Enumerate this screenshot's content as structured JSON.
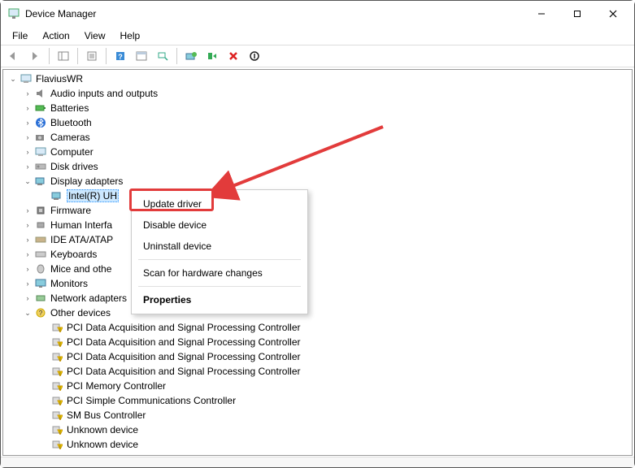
{
  "window": {
    "title": "Device Manager"
  },
  "menu": {
    "file": "File",
    "action": "Action",
    "view": "View",
    "help": "Help"
  },
  "root": {
    "name": "FlaviusWR"
  },
  "categories": {
    "audio": "Audio inputs and outputs",
    "batteries": "Batteries",
    "bluetooth": "Bluetooth",
    "cameras": "Cameras",
    "computer": "Computer",
    "disk": "Disk drives",
    "display": "Display adapters",
    "firmware": "Firmware",
    "hid": "Human Interfa",
    "ide": "IDE ATA/ATAP",
    "keyboards": "Keyboards",
    "mice": "Mice and othe",
    "monitors": "Monitors",
    "network": "Network adapters",
    "other": "Other devices"
  },
  "display_child": "Intel(R) UH",
  "other_devices": {
    "d0": "PCI Data Acquisition and Signal Processing Controller",
    "d1": "PCI Data Acquisition and Signal Processing Controller",
    "d2": "PCI Data Acquisition and Signal Processing Controller",
    "d3": "PCI Data Acquisition and Signal Processing Controller",
    "d4": "PCI Memory Controller",
    "d5": "PCI Simple Communications Controller",
    "d6": "SM Bus Controller",
    "d7": "Unknown device",
    "d8": "Unknown device"
  },
  "context_menu": {
    "update": "Update driver",
    "disable": "Disable device",
    "uninstall": "Uninstall device",
    "scan": "Scan for hardware changes",
    "properties": "Properties"
  }
}
